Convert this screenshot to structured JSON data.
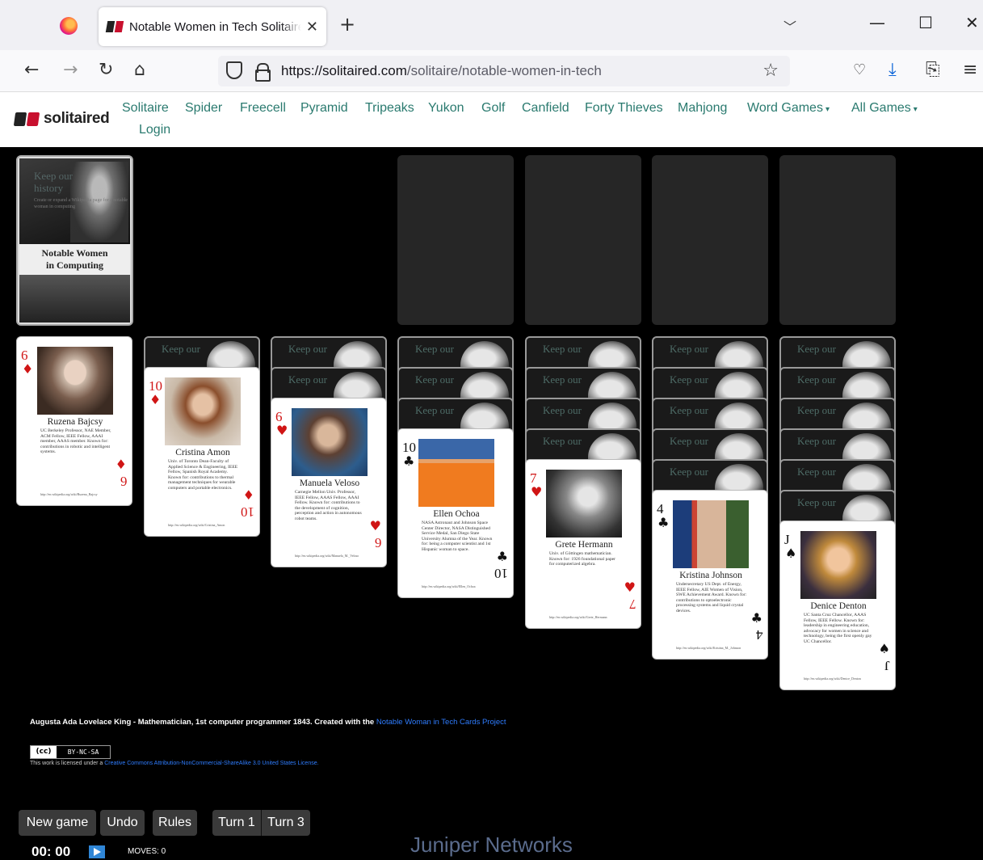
{
  "browser": {
    "tab_title": "Notable Women in Tech Solitaire",
    "tab_close": "✕",
    "new_tab": "+",
    "url_host": "https://solitaired.com",
    "url_path": "/solitaire/notable-women-in-tech"
  },
  "site": {
    "brand": "solitaired",
    "nav": [
      {
        "label": "Solitaire"
      },
      {
        "label": "Spider"
      },
      {
        "label": "Freecell"
      },
      {
        "label": "Pyramid"
      },
      {
        "label": "Tripeaks"
      },
      {
        "label": "Yukon"
      },
      {
        "label": "Golf"
      },
      {
        "label": "Canfield"
      },
      {
        "label": "Forty Thieves"
      },
      {
        "label": "Mahjong"
      },
      {
        "label": "Word Games"
      },
      {
        "label": "All Games"
      },
      {
        "label": "Login"
      }
    ],
    "caret": "▾"
  },
  "stock": {
    "keep_line1": "Keep our",
    "keep_line2": "history",
    "tagline": "Create or expand a Wikipedia page for a notable woman in computing",
    "banner_line1": "Notable Women",
    "banner_line2": "in Computing"
  },
  "card_back_text": "Keep our",
  "tableau": [
    {
      "rank": "6",
      "suit": "♦",
      "color": "red",
      "name": "Ruzena Bajcsy",
      "desc": "UC Berkeley Professor, NAE Member, ACM Fellow, IEEE Fellow, AAAI member, AAAS member. Known for: contributions in robotic and intelligent systems.",
      "link": "http://en.wikipedia.org/wiki/Ruzena_Bajcsy"
    },
    {
      "rank": "10",
      "suit": "♦",
      "color": "red",
      "name": "Cristina Amon",
      "desc": "Univ. of Toronto Dean-Faculty of Applied Science & Engineering, IEEE Fellow, Spanish Royal Academy. Known for: contributions to thermal management techniques for wearable computers and portable electronics.",
      "link": "http://en.wikipedia.org/wiki/Cristina_Amon"
    },
    {
      "rank": "6",
      "suit": "♥",
      "color": "red",
      "name": "Manuela Veloso",
      "desc": "Carnegie Mellon Univ. Professor, IEEE Fellow, AAAS Fellow, AAAI Fellow. Known for: contributions to the development of cognition, perception and action in autonomous robot teams.",
      "link": "http://en.wikipedia.org/wiki/Manuela_M._Veloso"
    },
    {
      "rank": "10",
      "suit": "♣",
      "color": "blk",
      "name": "Ellen Ochoa",
      "desc": "NASA Astronaut and Johnson Space Center Director, NASA Distinguished Service Medal, San Diego State University Alumna of the Year. Known for: being a computer scientist and 1st Hispanic woman to space.",
      "link": "http://en.wikipedia.org/wiki/Ellen_Ochoa"
    },
    {
      "rank": "7",
      "suit": "♥",
      "color": "red",
      "name": "Grete Hermann",
      "desc": "Univ. of Göttingen mathematician. Known for: 1926 foundational paper for computerized algebra.",
      "link": "http://en.wikipedia.org/wiki/Grete_Hermann"
    },
    {
      "rank": "4",
      "suit": "♣",
      "color": "blk",
      "name": "Kristina Johnson",
      "desc": "Undersecretary US Dept. of Energy, IEEE Fellow, AIE Women of Vision, SWE Achievement Award. Known for: contributions to optoelectronic processing systems and liquid crystal devices.",
      "link": "http://en.wikipedia.org/wiki/Kristina_M._Johnson"
    },
    {
      "rank": "J",
      "suit": "♠",
      "color": "blk",
      "name": "Denice Denton",
      "desc": "UC Santa Cruz Chancellor, AAAS Fellow, IEEE Fellow. Known for: leadership in engineering education, advocacy for women in science and technology, being the first openly gay UC Chancellor.",
      "link": "http://en.wikipedia.org/wiki/Denice_Denton"
    }
  ],
  "footer": {
    "credit": "Augusta Ada Lovelace King - Mathematician, 1st computer programmer 1843. Created with the ",
    "credit_link": "Notable Woman in Tech Cards Project",
    "cc": "(cc)",
    "cc_terms": "BY-NC-SA",
    "license_prefix": "This work is licensed under a ",
    "license_link": "Creative Commons Attribution-NonCommercial-ShareAlike 3.0 United States License."
  },
  "controls": {
    "new_game": "New game",
    "undo": "Undo",
    "rules": "Rules",
    "turn1": "Turn 1",
    "turn3": "Turn 3",
    "timer": "00: 00",
    "moves": "MOVES: 0"
  },
  "overlay_text": "Juniper Networks",
  "colors": {
    "accent_link": "#2a7a6f",
    "card_red": "#d01515",
    "brand_red": "#c8102e"
  }
}
